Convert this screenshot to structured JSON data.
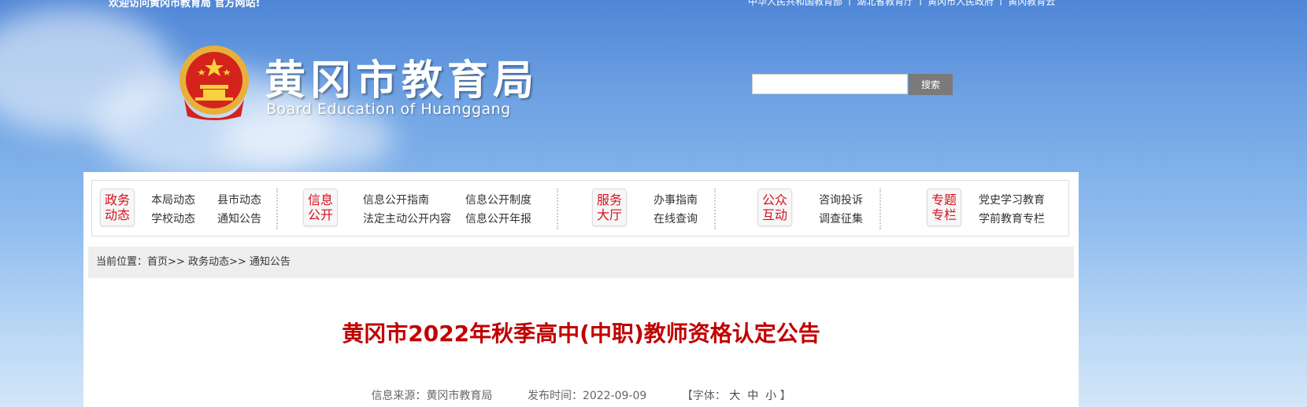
{
  "top": {
    "welcome": "欢迎访问黄冈市教育局 官方网站!",
    "links": [
      "中华人民共和国教育部",
      "湖北省教育厅",
      "黄冈市人民政府",
      "黄冈教育云"
    ],
    "separator": "|"
  },
  "header": {
    "title": "黄冈市教育局",
    "subtitle": "Board Education of Huanggang"
  },
  "search": {
    "placeholder": "",
    "value": "",
    "button_label": "搜索"
  },
  "nav": {
    "groups": [
      {
        "category": "政务\n动态",
        "links": [
          "本局动态",
          "县市动态",
          "学校动态",
          "通知公告"
        ]
      },
      {
        "category": "信息\n公开",
        "links": [
          "信息公开指南",
          "信息公开制度",
          "法定主动公开内容",
          "信息公开年报"
        ]
      },
      {
        "category": "服务\n大厅",
        "links": [
          "办事指南",
          "在线查询"
        ]
      },
      {
        "category": "公众\n互动",
        "links": [
          "咨询投诉",
          "调查征集"
        ]
      },
      {
        "category": "专题\n专栏",
        "links": [
          "党史学习教育",
          "学前教育专栏"
        ]
      }
    ]
  },
  "breadcrumb": {
    "label": "当前位置：",
    "items": [
      "首页",
      "政务动态",
      "通知公告"
    ],
    "separator": ">>"
  },
  "article": {
    "title": "黄冈市2022年秋季高中(中职)教师资格认定公告",
    "source_label": "信息来源：",
    "source": "黄冈市教育局",
    "date_label": "发布时间：",
    "date": "2022-09-09",
    "font_label": "【字体：",
    "font_sizes": [
      "大",
      "中",
      "小"
    ],
    "font_close": "】"
  },
  "colors": {
    "accent": "#c00000",
    "nav_category": "#d4111d",
    "search_button": "#7a7a7a"
  }
}
